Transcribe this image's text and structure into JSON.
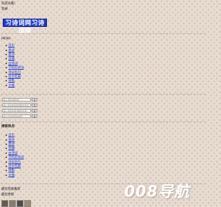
{
  "header": {
    "welcome_text": "欢迎光临!",
    "login_link": "登录"
  },
  "logo": {
    "text": "习诗词网习诗词网"
  },
  "menu": {
    "label": "MENU"
  },
  "nav": [
    {
      "label": "首页"
    },
    {
      "label": "春诗"
    },
    {
      "label": "夏诗"
    },
    {
      "label": "古曲"
    },
    {
      "label": "古诗词"
    },
    {
      "label": "不朽的诗词"
    },
    {
      "label": "诗词名句"
    },
    {
      "label": "古文名篇"
    },
    {
      "label": "诗集"
    },
    {
      "label": "文曲"
    }
  ],
  "searches": [
    {
      "placeholder": "输入诗词名称查找",
      "button": "搜"
    },
    {
      "placeholder": "输入诗句或诗词名称搜索查询",
      "button": "查"
    },
    {
      "placeholder": "输入诗词作者名称搜索查询",
      "button": "搜"
    },
    {
      "placeholder": "输入名句或诗词关键字",
      "button": "搜"
    }
  ],
  "popular": {
    "title": "搜索热点",
    "items": [
      {
        "label": "首页"
      },
      {
        "label": "春诗"
      },
      {
        "label": "夏诗"
      },
      {
        "label": "古曲"
      },
      {
        "label": "古诗词"
      },
      {
        "label": "不朽的诗词"
      },
      {
        "label": "诗词名句"
      },
      {
        "label": "古文名篇"
      },
      {
        "label": "诗集"
      },
      {
        "label": "文曲"
      }
    ]
  },
  "footer_lines": {
    "line1": "最近检索推荐",
    "line2": "最近更新"
  },
  "watermark": {
    "text": "008导航"
  },
  "colors": {
    "link": "#1a3ad6",
    "logo_bg": "#1e3bc9",
    "page_bg": "#e8dcd2"
  }
}
